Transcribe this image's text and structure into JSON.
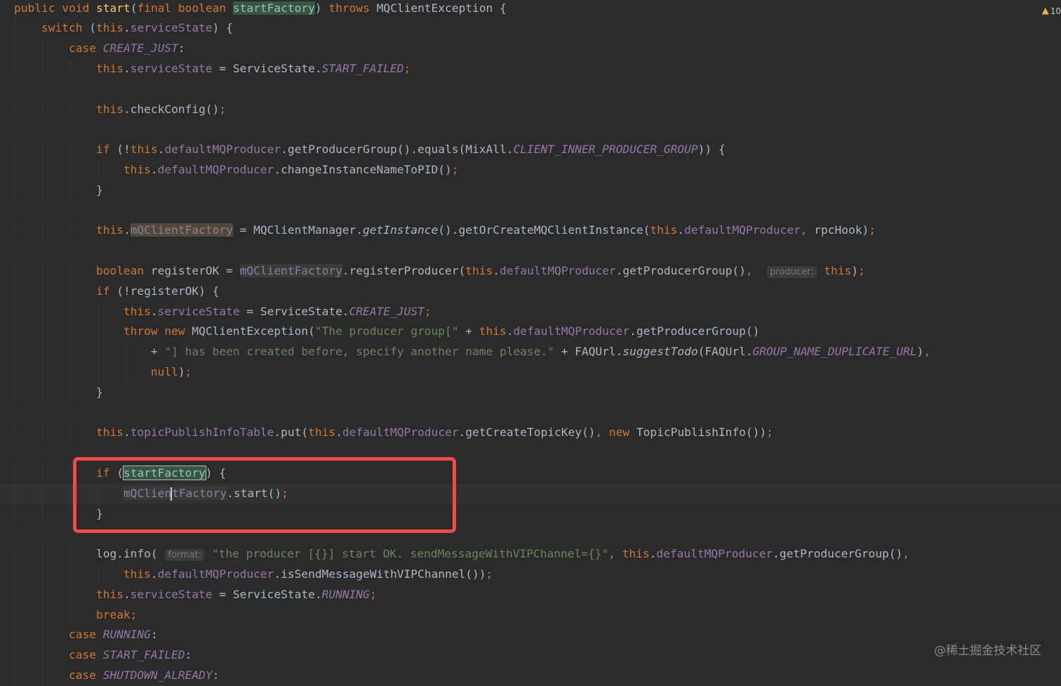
{
  "warning_indicator": {
    "icon": "warning-triangle-icon",
    "count": "10"
  },
  "annotation": {
    "color": "#f04b4b",
    "label": "highlighted block"
  },
  "watermark": "@稀土掘金技术社区",
  "lines": [
    {
      "tokens": [
        [
          "kw",
          "public"
        ],
        [
          "txt",
          " "
        ],
        [
          "kw",
          "void"
        ],
        [
          "txt",
          " "
        ],
        [
          "fn",
          "start"
        ],
        [
          "txt",
          "("
        ],
        [
          "kw",
          "final boolean"
        ],
        [
          "txt",
          " "
        ],
        [
          "param",
          "startFactory"
        ],
        [
          "txt",
          ") "
        ],
        [
          "kw",
          "throws"
        ],
        [
          "txt",
          " MQClientException {"
        ]
      ]
    },
    {
      "tokens": [
        [
          "txt",
          "    "
        ],
        [
          "kw",
          "switch"
        ],
        [
          "txt",
          " ("
        ],
        [
          "kw",
          "this"
        ],
        [
          "txt",
          "."
        ],
        [
          "fld",
          "serviceState"
        ],
        [
          "txt",
          ") {"
        ]
      ]
    },
    {
      "tokens": [
        [
          "txt",
          "        "
        ],
        [
          "kw",
          "case"
        ],
        [
          "txt",
          " "
        ],
        [
          "it",
          "CREATE_JUST"
        ],
        [
          "txt",
          ":"
        ]
      ]
    },
    {
      "tokens": [
        [
          "txt",
          "            "
        ],
        [
          "kw",
          "this"
        ],
        [
          "txt",
          "."
        ],
        [
          "fld",
          "serviceState"
        ],
        [
          "txt",
          " = ServiceState."
        ],
        [
          "it",
          "START_FAILED"
        ],
        [
          "kw",
          ";"
        ]
      ]
    },
    {
      "tokens": []
    },
    {
      "tokens": [
        [
          "txt",
          "            "
        ],
        [
          "kw",
          "this"
        ],
        [
          "txt",
          ".checkConfig()"
        ],
        [
          "kw",
          ";"
        ]
      ]
    },
    {
      "tokens": []
    },
    {
      "tokens": [
        [
          "txt",
          "            "
        ],
        [
          "kw",
          "if"
        ],
        [
          "txt",
          " (!"
        ],
        [
          "kw",
          "this"
        ],
        [
          "txt",
          "."
        ],
        [
          "fld",
          "defaultMQProducer"
        ],
        [
          "txt",
          ".getProducerGroup().equals(MixAll."
        ],
        [
          "it",
          "CLIENT_INNER_PRODUCER_GROUP"
        ],
        [
          "txt",
          ")) {"
        ]
      ]
    },
    {
      "tokens": [
        [
          "txt",
          "                "
        ],
        [
          "kw",
          "this"
        ],
        [
          "txt",
          "."
        ],
        [
          "fld",
          "defaultMQProducer"
        ],
        [
          "txt",
          ".changeInstanceNameToPID()"
        ],
        [
          "kw",
          ";"
        ]
      ]
    },
    {
      "tokens": [
        [
          "txt",
          "            }"
        ]
      ]
    },
    {
      "tokens": []
    },
    {
      "tokens": [
        [
          "txt",
          "            "
        ],
        [
          "kw",
          "this"
        ],
        [
          "txt",
          "."
        ],
        [
          "warnfld",
          "mQClientFactory"
        ],
        [
          "txt",
          " = MQClientManager."
        ],
        [
          "mi",
          "getInstance"
        ],
        [
          "txt",
          "().getOrCreateMQClientInstance("
        ],
        [
          "kw",
          "this"
        ],
        [
          "txt",
          "."
        ],
        [
          "fld",
          "defaultMQProducer"
        ],
        [
          "kw",
          ", "
        ],
        [
          "txt",
          "rpcHook)"
        ],
        [
          "kw",
          ";"
        ]
      ]
    },
    {
      "tokens": []
    },
    {
      "tokens": [
        [
          "txt",
          "            "
        ],
        [
          "kw",
          "boolean"
        ],
        [
          "txt",
          " registerOK = "
        ],
        [
          "usefld",
          "mQClientFactory"
        ],
        [
          "txt",
          ".registerProducer("
        ],
        [
          "kw",
          "this"
        ],
        [
          "txt",
          "."
        ],
        [
          "fld",
          "defaultMQProducer"
        ],
        [
          "txt",
          ".getProducerGroup()"
        ],
        [
          "kw",
          ", "
        ],
        [
          "txt",
          " "
        ],
        [
          "hint",
          "producer:"
        ],
        [
          "txt",
          " "
        ],
        [
          "kw",
          "this"
        ],
        [
          "txt",
          ")"
        ],
        [
          "kw",
          ";"
        ]
      ]
    },
    {
      "tokens": [
        [
          "txt",
          "            "
        ],
        [
          "kw",
          "if"
        ],
        [
          "txt",
          " (!registerOK) {"
        ]
      ]
    },
    {
      "tokens": [
        [
          "txt",
          "                "
        ],
        [
          "kw",
          "this"
        ],
        [
          "txt",
          "."
        ],
        [
          "fld",
          "serviceState"
        ],
        [
          "txt",
          " = ServiceState."
        ],
        [
          "it",
          "CREATE_JUST"
        ],
        [
          "kw",
          ";"
        ]
      ]
    },
    {
      "tokens": [
        [
          "txt",
          "                "
        ],
        [
          "kw",
          "throw new"
        ],
        [
          "txt",
          " MQClientException("
        ],
        [
          "str",
          "\"The producer group[\""
        ],
        [
          "txt",
          " + "
        ],
        [
          "kw",
          "this"
        ],
        [
          "txt",
          "."
        ],
        [
          "fld",
          "defaultMQProducer"
        ],
        [
          "txt",
          ".getProducerGroup()"
        ]
      ]
    },
    {
      "tokens": [
        [
          "txt",
          "                    + "
        ],
        [
          "str",
          "\"] has been created before, specify another name please.\""
        ],
        [
          "txt",
          " + FAQUrl."
        ],
        [
          "mi",
          "suggestTodo"
        ],
        [
          "txt",
          "(FAQUrl."
        ],
        [
          "it",
          "GROUP_NAME_DUPLICATE_URL"
        ],
        [
          "txt",
          ")"
        ],
        [
          "kw",
          ","
        ]
      ]
    },
    {
      "tokens": [
        [
          "txt",
          "                    "
        ],
        [
          "kw",
          "null"
        ],
        [
          "txt",
          ")"
        ],
        [
          "kw",
          ";"
        ]
      ]
    },
    {
      "tokens": [
        [
          "txt",
          "            }"
        ]
      ]
    },
    {
      "tokens": []
    },
    {
      "tokens": [
        [
          "txt",
          "            "
        ],
        [
          "kw",
          "this"
        ],
        [
          "txt",
          "."
        ],
        [
          "fld",
          "topicPublishInfoTable"
        ],
        [
          "txt",
          ".put("
        ],
        [
          "kw",
          "this"
        ],
        [
          "txt",
          "."
        ],
        [
          "fld",
          "defaultMQProducer"
        ],
        [
          "txt",
          ".getCreateTopicKey()"
        ],
        [
          "kw",
          ", new"
        ],
        [
          "txt",
          " TopicPublishInfo())"
        ],
        [
          "kw",
          ";"
        ]
      ]
    },
    {
      "tokens": []
    },
    {
      "tokens": [
        [
          "txt",
          "            "
        ],
        [
          "kw",
          "if"
        ],
        [
          "txt",
          " ("
        ],
        [
          "boxparam",
          "startFactory"
        ],
        [
          "txt",
          ") {"
        ]
      ]
    },
    {
      "current": true,
      "tokens": [
        [
          "txt",
          "                "
        ],
        [
          "usefld",
          "mQClien"
        ],
        [
          "caret",
          ""
        ],
        [
          "usefld",
          "tFactory"
        ],
        [
          "txt",
          ".start()"
        ],
        [
          "kw",
          ";"
        ]
      ]
    },
    {
      "tokens": [
        [
          "txt",
          "            }"
        ]
      ]
    },
    {
      "tokens": []
    },
    {
      "tokens": [
        [
          "txt",
          "            log.info( "
        ],
        [
          "hint",
          "format:"
        ],
        [
          "txt",
          " "
        ],
        [
          "str",
          "\"the producer [{}] start OK. sendMessageWithVIPChannel={}\""
        ],
        [
          "kw",
          ", "
        ],
        [
          "kw",
          "this"
        ],
        [
          "txt",
          "."
        ],
        [
          "fld",
          "defaultMQProducer"
        ],
        [
          "txt",
          ".getProducerGroup()"
        ],
        [
          "kw",
          ","
        ]
      ]
    },
    {
      "tokens": [
        [
          "txt",
          "                "
        ],
        [
          "kw",
          "this"
        ],
        [
          "txt",
          "."
        ],
        [
          "fld",
          "defaultMQProducer"
        ],
        [
          "txt",
          ".isSendMessageWithVIPChannel())"
        ],
        [
          "kw",
          ";"
        ]
      ]
    },
    {
      "tokens": [
        [
          "txt",
          "            "
        ],
        [
          "kw",
          "this"
        ],
        [
          "txt",
          "."
        ],
        [
          "fld",
          "serviceState"
        ],
        [
          "txt",
          " = ServiceState."
        ],
        [
          "it",
          "RUNNING"
        ],
        [
          "kw",
          ";"
        ]
      ]
    },
    {
      "tokens": [
        [
          "txt",
          "            "
        ],
        [
          "kw",
          "break;"
        ]
      ]
    },
    {
      "tokens": [
        [
          "txt",
          "        "
        ],
        [
          "kw",
          "case"
        ],
        [
          "txt",
          " "
        ],
        [
          "it",
          "RUNNING"
        ],
        [
          "txt",
          ":"
        ]
      ]
    },
    {
      "tokens": [
        [
          "txt",
          "        "
        ],
        [
          "kw",
          "case"
        ],
        [
          "txt",
          " "
        ],
        [
          "it",
          "START_FAILED"
        ],
        [
          "txt",
          ":"
        ]
      ]
    },
    {
      "tokens": [
        [
          "txt",
          "        "
        ],
        [
          "kw",
          "case"
        ],
        [
          "txt",
          " "
        ],
        [
          "it",
          "SHUTDOWN_ALREADY"
        ],
        [
          "txt",
          ":"
        ]
      ]
    }
  ]
}
